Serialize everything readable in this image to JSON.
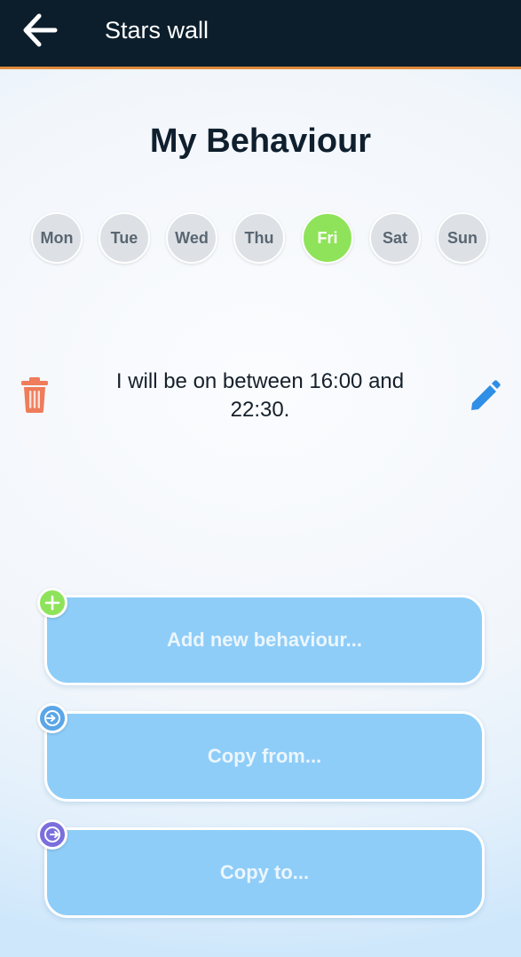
{
  "header": {
    "title": "Stars wall",
    "back_icon": "arrow-left-icon"
  },
  "page": {
    "title": "My Behaviour"
  },
  "days": [
    {
      "label": "Mon",
      "selected": false
    },
    {
      "label": "Tue",
      "selected": false
    },
    {
      "label": "Wed",
      "selected": false
    },
    {
      "label": "Thu",
      "selected": false
    },
    {
      "label": "Fri",
      "selected": true
    },
    {
      "label": "Sat",
      "selected": false
    },
    {
      "label": "Sun",
      "selected": false
    }
  ],
  "behaviour": {
    "text": "I will be on between 16:00 and 22:30.",
    "delete_icon": "trash-icon",
    "edit_icon": "pencil-icon"
  },
  "actions": {
    "add_label": "Add new behaviour...",
    "copy_from_label": "Copy from...",
    "copy_to_label": "Copy to..."
  },
  "colors": {
    "header_bg": "#0c1e2c",
    "header_border": "#e08a3a",
    "selected_day": "#8fe35a",
    "day_default": "#dde1e5",
    "button_bg": "#8ecdf8",
    "trash": "#ef7c5a",
    "edit": "#2f8ee6",
    "badge_add": "#8fe35a",
    "badge_copy_from": "#5aa6e8",
    "badge_copy_to": "#7a6fdc"
  }
}
